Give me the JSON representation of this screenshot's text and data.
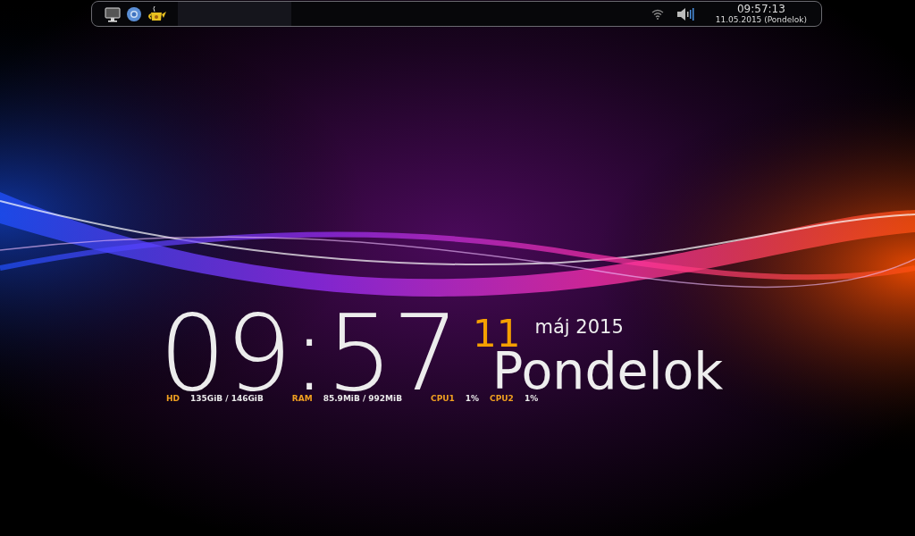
{
  "panel": {
    "clock": {
      "time": "09:57:13",
      "date": "11.05.2015 (Pondelok)"
    }
  },
  "widget": {
    "time": "09:57",
    "day": "11",
    "month_year": "máj 2015",
    "weekday": "Pondelok",
    "stats": [
      {
        "label": "HD",
        "value": "135GiB / 146GiB"
      },
      {
        "label": "RAM",
        "value": "85.9MiB / 992MiB"
      },
      {
        "label": "CPU1",
        "value": "1%"
      },
      {
        "label": "CPU2",
        "value": "1%"
      }
    ]
  }
}
